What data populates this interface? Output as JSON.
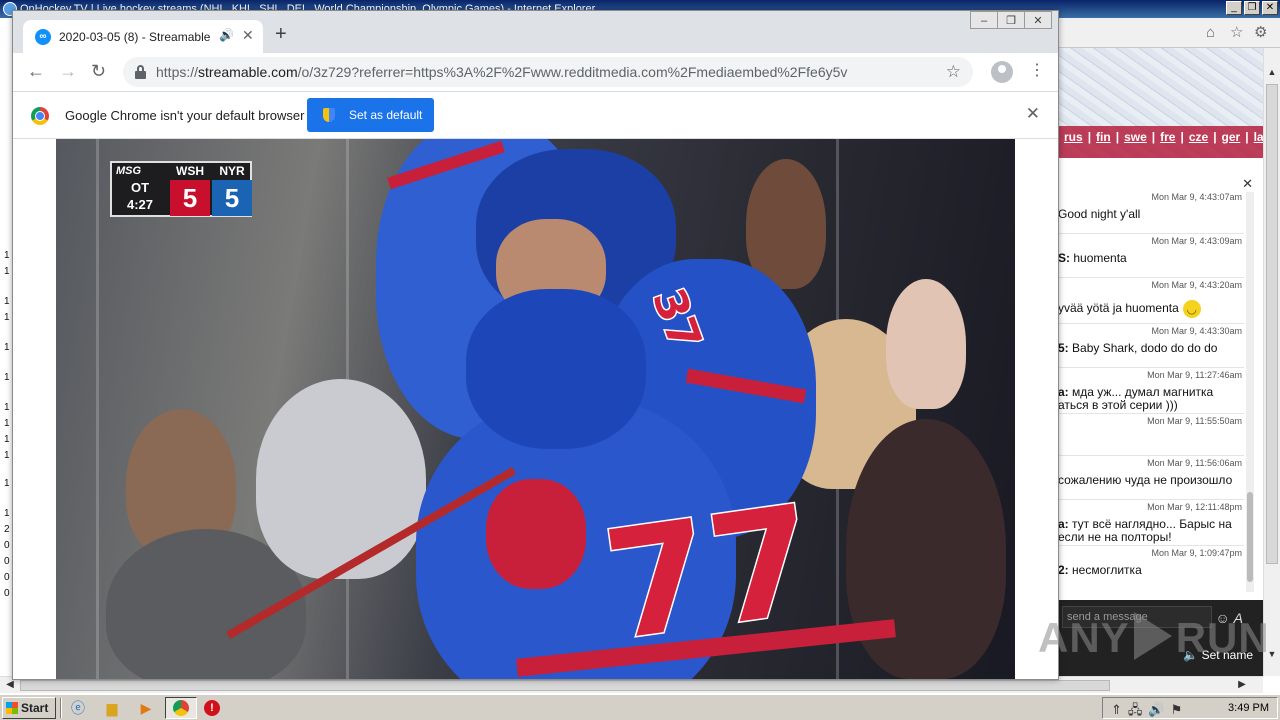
{
  "ie": {
    "title": "OnHockey.TV | Live hockey streams (NHL, KHL, SHL, DEL, World Championship, Olympic Games) - Internet Explorer",
    "lang_links": [
      "rus",
      "fin",
      "swe",
      "fre",
      "cze",
      "ger",
      "la"
    ],
    "left_strip": [
      "1",
      "1",
      "1",
      "1",
      "1",
      "1",
      "1",
      "1",
      "1",
      "1",
      "1",
      "1",
      "2",
      "0",
      "0",
      "0",
      "0"
    ]
  },
  "chat": {
    "messages": [
      {
        "time": "Mon Mar 9, 4:43:07am",
        "user": "",
        "text": "Good night y'all"
      },
      {
        "time": "Mon Mar 9, 4:43:09am",
        "user": "S:",
        "text": "huomenta"
      },
      {
        "time": "Mon Mar 9, 4:43:20am",
        "user": "",
        "text": "yvää yötä ja huomenta"
      },
      {
        "time": "Mon Mar 9, 4:43:30am",
        "user": "5:",
        "text": "Baby Shark, dodo do do do"
      },
      {
        "time": "Mon Mar 9, 11:27:46am",
        "user": "a:",
        "text": "мда уж... думал магнитка",
        "text2": "аться в этой серии )))"
      },
      {
        "time": "Mon Mar 9, 11:55:50am",
        "user": "",
        "text": ""
      },
      {
        "time": "Mon Mar 9, 11:56:06am",
        "user": "",
        "text": "сожалению чуда не произошло"
      },
      {
        "time": "Mon Mar 9, 12:11:48pm",
        "user": "a:",
        "text": "тут всё наглядно... Барыс на",
        "text2": "если не на полторы!"
      },
      {
        "time": "Mon Mar 9, 1:09:47pm",
        "user": "2:",
        "text": "несмоглитка"
      }
    ],
    "input_placeholder": "send a message",
    "set_name": "Set name"
  },
  "chrome": {
    "tab_title": "2020-03-05 (8) - Streamable",
    "url_scheme": "https://",
    "url_host": "streamable.com",
    "url_path": "/o/3z729?referrer=https%3A%2F%2Fwww.redditmedia.com%2Fmediaembed%2Ffe6y5v",
    "infobar_message": "Google Chrome isn't your default browser",
    "set_default_label": "Set as default"
  },
  "scorebug": {
    "network": "MSG",
    "period": "OT",
    "clock": "4:27",
    "away_team": "WSH",
    "away_score": "5",
    "home_team": "NYR",
    "home_score": "5",
    "away_color": "#c8102e",
    "home_color": "#1b64b4"
  },
  "video": {
    "jersey_number": "77",
    "jersey_number_upper": "37"
  },
  "watermark": {
    "text_left": "ANY",
    "text_right": "RUN"
  },
  "taskbar": {
    "start_label": "Start",
    "clock": "3:49 PM"
  }
}
